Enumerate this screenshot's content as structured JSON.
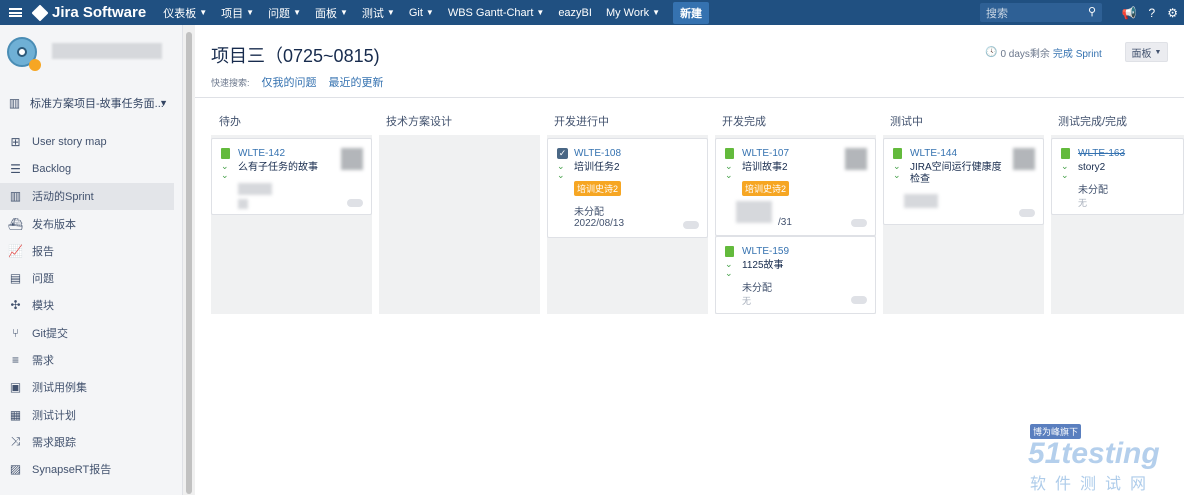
{
  "nav": {
    "logo": "Jira Software",
    "items": [
      {
        "label": "仪表板",
        "caret": true
      },
      {
        "label": "项目",
        "caret": true
      },
      {
        "label": "问题",
        "caret": true
      },
      {
        "label": "面板",
        "caret": true
      },
      {
        "label": "测试",
        "caret": true
      },
      {
        "label": "Git",
        "caret": true
      },
      {
        "label": "WBS Gantt-Chart",
        "caret": true
      },
      {
        "label": "eazyBI",
        "caret": false
      },
      {
        "label": "My Work",
        "caret": true
      }
    ],
    "create": "新建",
    "search_placeholder": "搜索"
  },
  "sidebar": {
    "project": "标准方案项目-故事任务面...",
    "items": [
      {
        "label": "User story map",
        "icon": "story-map-icon"
      },
      {
        "label": "Backlog",
        "icon": "backlog-icon"
      },
      {
        "label": "活动的Sprint",
        "icon": "board-icon",
        "active": true
      },
      {
        "label": "发布版本",
        "icon": "ship-icon"
      },
      {
        "label": "报告",
        "icon": "chart-icon"
      },
      {
        "label": "问题",
        "icon": "issues-icon"
      },
      {
        "label": "模块",
        "icon": "puzzle-icon"
      },
      {
        "label": "Git提交",
        "icon": "git-icon"
      },
      {
        "label": "需求",
        "icon": "requirement-icon"
      },
      {
        "label": "测试用例集",
        "icon": "testcase-icon"
      },
      {
        "label": "测试计划",
        "icon": "testplan-icon"
      },
      {
        "label": "需求跟踪",
        "icon": "trace-icon"
      },
      {
        "label": "SynapseRT报告",
        "icon": "report-icon"
      }
    ]
  },
  "header": {
    "title": "项目三（0725~0815)",
    "quick_label": "快速搜索:",
    "quick_filters": [
      "仅我的问题",
      "最近的更新"
    ],
    "days": "0 days剩余",
    "complete": "完成 Sprint",
    "board": "面板"
  },
  "columns": [
    "待办",
    "技术方案设计",
    "开发进行中",
    "开发完成",
    "测试中",
    "测试完成/完成"
  ],
  "cards": {
    "c1": {
      "key": "WLTE-142",
      "summary": "么有子任务的故事"
    },
    "c2": {
      "key": "WLTE-108",
      "summary": "培训任务2",
      "epic": "培训史诗2",
      "assignee": "未分配",
      "date": "2022/08/13"
    },
    "c3": {
      "key": "WLTE-107",
      "summary": "培训故事2",
      "epic": "培训史诗2",
      "date_tail": "/31"
    },
    "c4": {
      "key": "WLTE-159",
      "summary": "1125故事",
      "assignee": "未分配",
      "extra": "无"
    },
    "c5": {
      "key": "WLTE-144",
      "summary1": "JIRA空间运行健康度",
      "summary2": "检查"
    },
    "c6": {
      "key": "WLTE-163",
      "summary": "story2",
      "assignee": "未分配",
      "extra": "无"
    }
  },
  "watermark": {
    "tag": "博为峰旗下",
    "brand": "51testing",
    "cn": "软件测试网"
  }
}
